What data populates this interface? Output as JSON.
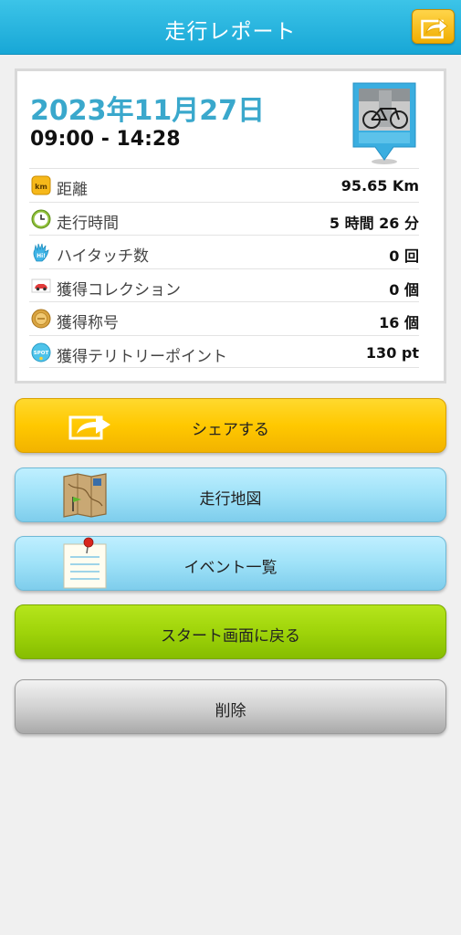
{
  "header": {
    "title": "走行レポート",
    "share_icon": "share-arrow-icon"
  },
  "report": {
    "date": "2023年11月27日",
    "time_range": "09:00 - 14:28",
    "photo_icon": "bicycle-photo-pin-icon",
    "stats": [
      {
        "label": "距離",
        "value": "95.65 Km",
        "icon": "km-icon"
      },
      {
        "label": "走行時間",
        "value": "5 時間 26 分",
        "icon": "clock-icon"
      },
      {
        "label": "ハイタッチ数",
        "value": "0 回",
        "icon": "hi-touch-hand-icon"
      },
      {
        "label": "獲得コレクション",
        "value": "0 個",
        "icon": "car-collection-icon"
      },
      {
        "label": "獲得称号",
        "value": "16 個",
        "icon": "medal-icon"
      },
      {
        "label": "獲得テリトリーポイント",
        "value": "130 pt",
        "icon": "spot-icon"
      }
    ],
    "icon_texts": {
      "km": "km",
      "hi": "Hi!",
      "spot": "SPOT"
    }
  },
  "buttons": {
    "share": "シェアする",
    "map": "走行地図",
    "events": "イベント一覧",
    "start": "スタート画面に戻る",
    "delete": "削除"
  },
  "colors": {
    "header": "#18a7d6",
    "date": "#3aa8cc",
    "share_button": "#ffc800",
    "map_button": "#9fe2f8",
    "start_button": "#9fd40a",
    "delete_button": "#cfcfcf"
  }
}
